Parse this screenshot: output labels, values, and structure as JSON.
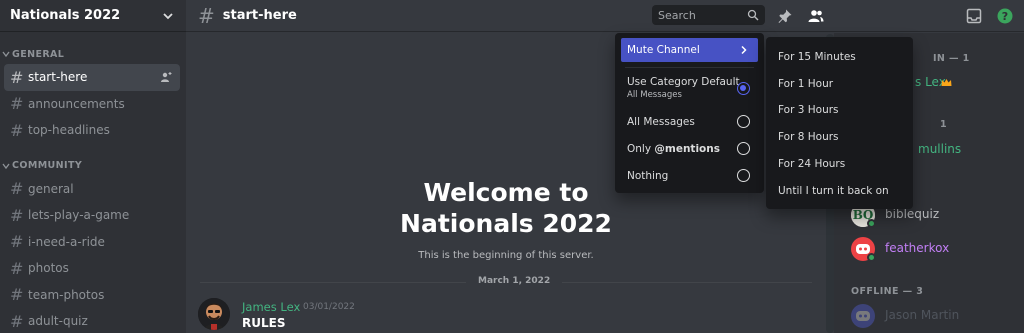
{
  "server": {
    "name": "Nationals 2022"
  },
  "sidebar": {
    "categories": [
      {
        "label": "GENERAL",
        "channels": [
          "start-here",
          "announcements",
          "top-headlines"
        ]
      },
      {
        "label": "COMMUNITY",
        "channels": [
          "general",
          "lets-play-a-game",
          "i-need-a-ride",
          "photos",
          "team-photos",
          "adult-quiz"
        ]
      }
    ],
    "active_channel": "start-here"
  },
  "topbar": {
    "channel_name": "start-here",
    "search_placeholder": "Search"
  },
  "chat": {
    "welcome_line1": "Welcome to",
    "welcome_line2": "Nationals 2022",
    "beginning": "This is the beginning of this server.",
    "date_divider": "March 1, 2022",
    "message": {
      "author": "James Lex",
      "date": "03/01/2022",
      "text": "RULES"
    }
  },
  "notification_menu": {
    "header": "Mute Channel",
    "options": [
      {
        "label": "Use Category Default",
        "sub": "All Messages",
        "selected": true
      },
      {
        "label": "All Messages",
        "selected": false
      },
      {
        "label": "Only @mentions",
        "selected": false
      },
      {
        "label": "Nothing",
        "selected": false
      }
    ]
  },
  "mute_submenu": {
    "options": [
      "For 15 Minutes",
      "For 1 Hour",
      "For 3 Hours",
      "For 8 Hours",
      "For 24 Hours",
      "Until I turn it back on"
    ]
  },
  "members": {
    "partial_top": {
      "section": "IN — 1",
      "name": "s Lex"
    },
    "partial_mid": {
      "count": "1",
      "name": "mullins"
    },
    "visible": [
      {
        "name": "biblequiz",
        "color": "#b9bbbe"
      },
      {
        "name": "featherkox",
        "color": "#c27ff5"
      }
    ],
    "offline_section": "OFFLINE — 3",
    "offline_first": "Jason Martin"
  },
  "colors": {
    "accent": "#5865f2",
    "menu_highlight": "#4752c4",
    "online": "#3ba55d",
    "author_green": "#43b581"
  }
}
